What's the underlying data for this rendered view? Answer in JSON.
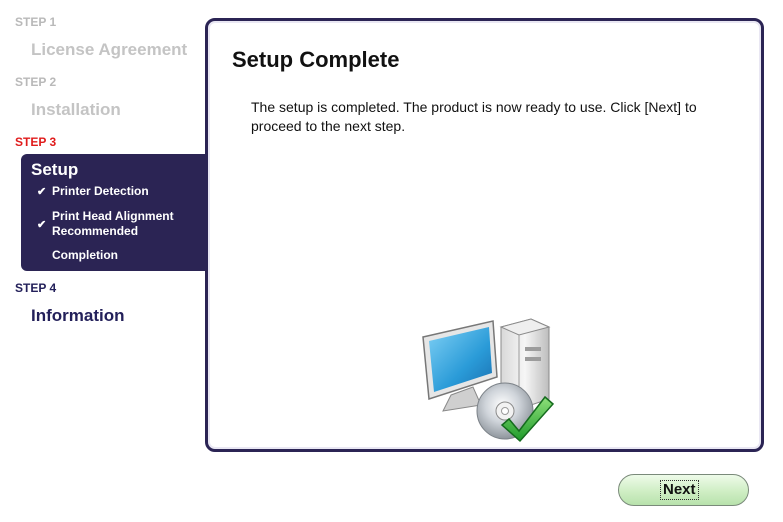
{
  "sidebar": {
    "steps": [
      {
        "number": "STEP 1",
        "title": "License Agreement",
        "state": "done"
      },
      {
        "number": "STEP 2",
        "title": "Installation",
        "state": "done"
      },
      {
        "number": "STEP 3",
        "title": "Setup",
        "state": "active"
      },
      {
        "number": "STEP 4",
        "title": "Information",
        "state": "upcoming"
      }
    ],
    "substeps": [
      {
        "label": "Printer Detection",
        "check": "✔"
      },
      {
        "label": "Print Head Alignment Recommended",
        "check": "✔"
      },
      {
        "label": "Completion",
        "check": ""
      }
    ]
  },
  "main": {
    "title": "Setup Complete",
    "message": "The setup is completed. The product is now ready to use. Click [Next] to proceed to the next step.",
    "illustration_icon": "computer-with-disc-and-checkmark-icon"
  },
  "footer": {
    "next_label": "Next"
  },
  "colors": {
    "sidebar_active_bg": "#2b2454",
    "active_step_number": "#e01b1b",
    "inactive_step_text": "#c4c4c4",
    "next_button_green": "#cfeec4"
  }
}
